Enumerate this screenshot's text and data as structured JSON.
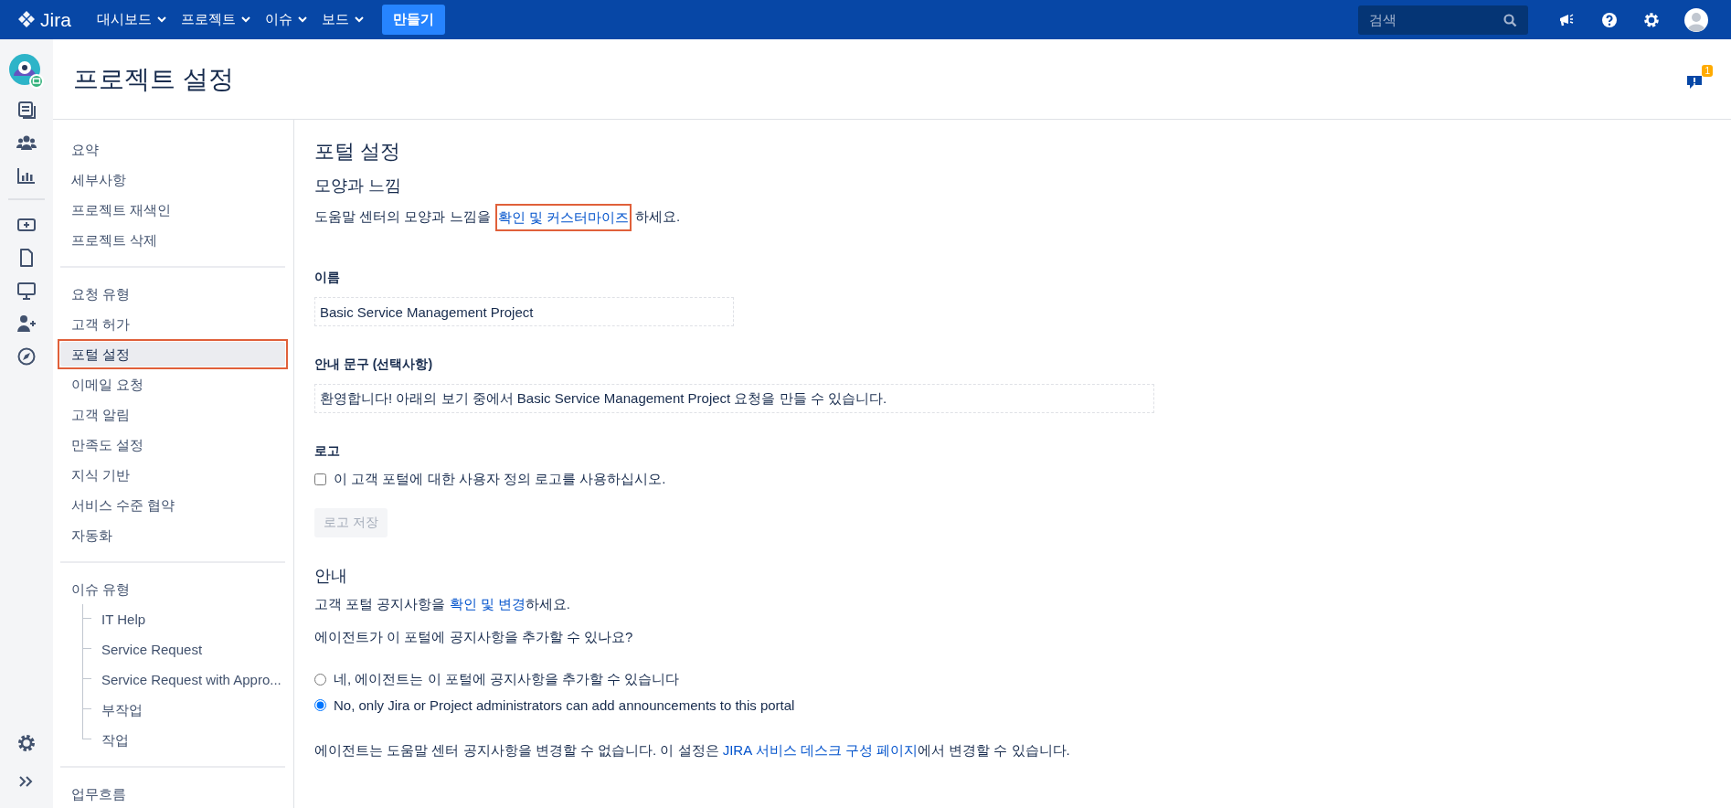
{
  "topbar": {
    "logo": "Jira",
    "nav": [
      "대시보드",
      "프로젝트",
      "이슈",
      "보드"
    ],
    "create_button": "만들기",
    "search": {
      "placeholder": "검색"
    }
  },
  "header": {
    "title": "프로젝트 설정",
    "feedback_badge": "1"
  },
  "sidebar": {
    "groups": [
      {
        "items": [
          {
            "label": "요약",
            "selected": false,
            "highlighted": false
          },
          {
            "label": "세부사항",
            "selected": false,
            "highlighted": false
          },
          {
            "label": "프로젝트 재색인",
            "selected": false,
            "highlighted": false
          },
          {
            "label": "프로젝트 삭제",
            "selected": false,
            "highlighted": false
          }
        ]
      },
      {
        "items": [
          {
            "label": "요청 유형",
            "selected": false,
            "highlighted": false
          },
          {
            "label": "고객 허가",
            "selected": false,
            "highlighted": false
          },
          {
            "label": "포털 설정",
            "selected": true,
            "highlighted": true
          },
          {
            "label": "이메일 요청",
            "selected": false,
            "highlighted": false
          },
          {
            "label": "고객 알림",
            "selected": false,
            "highlighted": false
          },
          {
            "label": "만족도 설정",
            "selected": false,
            "highlighted": false
          },
          {
            "label": "지식 기반",
            "selected": false,
            "highlighted": false
          },
          {
            "label": "서비스 수준 협약",
            "selected": false,
            "highlighted": false
          },
          {
            "label": "자동화",
            "selected": false,
            "highlighted": false
          }
        ]
      },
      {
        "items": [
          {
            "label": "이슈 유형",
            "selected": false,
            "highlighted": false,
            "children": [
              {
                "label": "IT Help",
                "selected": false
              },
              {
                "label": "Service Request",
                "selected": false
              },
              {
                "label": "Service Request with Appro...",
                "selected": false
              },
              {
                "label": "부작업",
                "selected": false
              },
              {
                "label": "작업",
                "selected": false
              }
            ]
          }
        ]
      },
      {
        "items": [
          {
            "label": "업무흐름",
            "selected": false,
            "highlighted": false
          }
        ]
      }
    ]
  },
  "main": {
    "title": "포털 설정",
    "look_and_feel": {
      "heading": "모양과 느낌",
      "text": {
        "before": "도움말 센터의 모양과 느낌을 ",
        "link": "확인 및 커스터마이즈",
        "after": "하세요.",
        "link_highlighted": true
      }
    },
    "name": {
      "label": "이름",
      "value": "Basic Service Management Project"
    },
    "intro": {
      "label": "안내 문구 (선택사항)",
      "value": "환영합니다! 아래의 보기 중에서 Basic Service Management Project 요청을 만들 수 있습니다."
    },
    "logo": {
      "label": "로고",
      "checkbox": {
        "label": "이 고객 포털에 대한 사용자 정의 로고를 사용하십시오.",
        "checked": false
      },
      "save_button": {
        "label": "로고 저장",
        "disabled": true
      }
    },
    "announcements": {
      "heading": "안내",
      "text": {
        "before": "고객 포털 공지사항을 ",
        "link": "확인 및 변경",
        "after": "하세요."
      },
      "question": "에이전트가 이 포털에 공지사항을 추가할 수 있나요?",
      "options": [
        {
          "label": "네, 에이전트는 이 포털에 공지사항을 추가할 수 있습니다",
          "selected": false
        },
        {
          "label": "No, only Jira or Project administrators can add announcements to this portal",
          "selected": true
        }
      ],
      "note": {
        "before": "에이전트는 도움말 센터 공지사항을 변경할 수 없습니다. 이 설정은 ",
        "link": "JIRA 서비스 데스크 구성 페이지",
        "after": "에서 변경할 수 있습니다."
      }
    }
  }
}
